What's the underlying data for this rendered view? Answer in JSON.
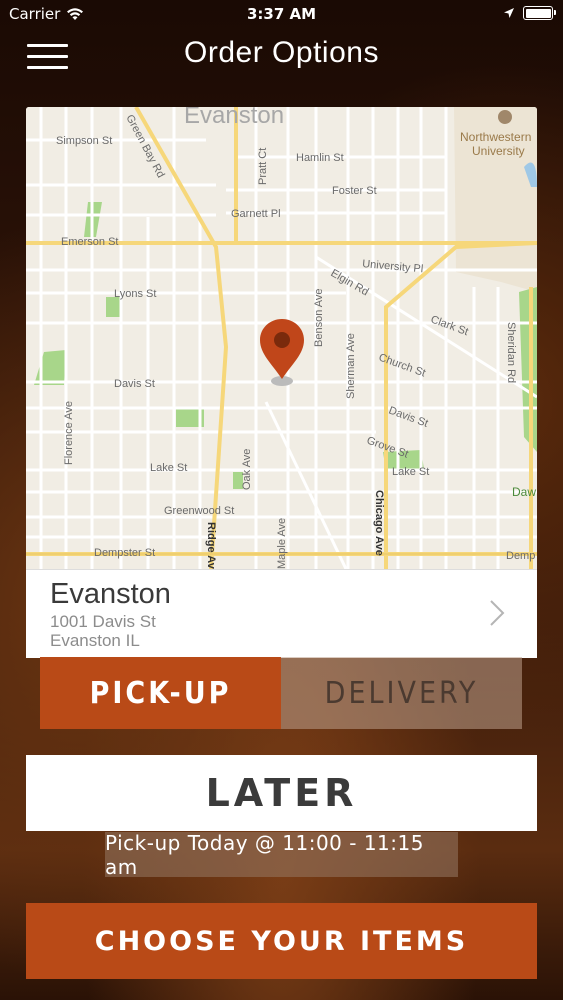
{
  "status_bar": {
    "carrier": "Carrier",
    "time": "3:37 AM"
  },
  "nav": {
    "title": "Order Options"
  },
  "map": {
    "streets": [
      "Evanston",
      "Simpson St",
      "Green Bay Rd",
      "Pratt Ct",
      "Hamlin St",
      "Foster St",
      "Garnett Pl",
      "Emerson St",
      "University Pl",
      "Elgin Rd",
      "Lyons St",
      "Clark St",
      "Benson Ave",
      "Sheridan Rd",
      "Davis St",
      "Church St",
      "Sherman Ave",
      "Florence Ave",
      "Davis St",
      "Grove St",
      "Lake St",
      "Oak Ave",
      "Lake St",
      "Greenwood St",
      "Chicago Ave",
      "Ridge Ave",
      "Dempster St",
      "Maple Ave",
      "Demp",
      "Daw",
      "Northwestern",
      "University"
    ]
  },
  "location": {
    "name": "Evanston",
    "address_line1": "1001 Davis St",
    "address_line2": "Evanston IL"
  },
  "options": {
    "pickup_label": "PICK-UP",
    "delivery_label": "DELIVERY",
    "selected": "PICK-UP"
  },
  "timing": {
    "later_label": "LATER",
    "pickup_time": "Pick-up Today @ 11:00 - 11:15 am"
  },
  "cta": {
    "label": "CHOOSE YOUR ITEMS"
  },
  "colors": {
    "accent": "#b94a17",
    "map_land": "#f1ede4",
    "park": "#a8d68a",
    "road_major": "#f6d77a",
    "pin": "#c0461a"
  }
}
